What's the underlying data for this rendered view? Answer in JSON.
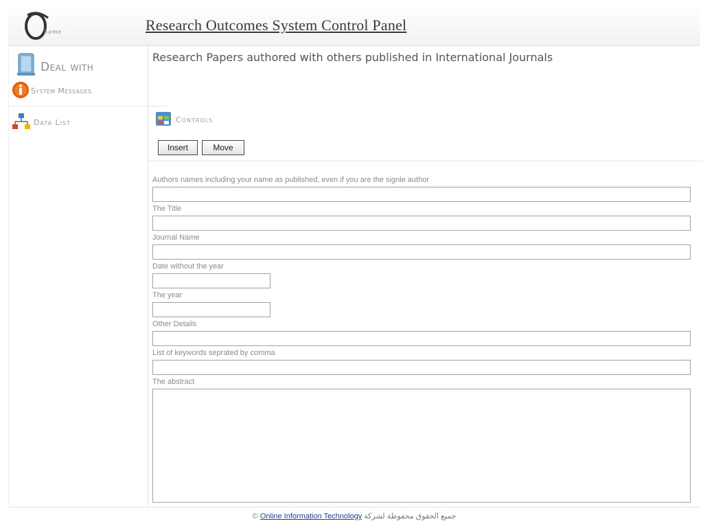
{
  "header": {
    "title": "Research Outcomes System Control Panel",
    "logo_text": "home"
  },
  "sidebar": {
    "deal_with": "Deal with",
    "system_messages": "System Messages",
    "data_list": "Data List"
  },
  "main": {
    "heading": "Research Papers authored with others published in International Journals",
    "controls_label": "Controls",
    "insert_label": "Insert",
    "move_label": "Move",
    "fields": {
      "authors": "Authors names including your name as published, even if you are the signle author",
      "title": "The Title",
      "journal": "Journal Name",
      "date": "Date without the year",
      "year": "The year",
      "other": "Other Details",
      "keywords": "List of keywords seprated by comma",
      "abstract": "The abstract"
    }
  },
  "footer": {
    "copyright": "©",
    "company_link": "Online Information Technology",
    "arabic_text": "جميع الحقوق محفوظة لشركة"
  },
  "colors": {
    "link": "#1a3fa8",
    "input_border": "#9aa2ab",
    "title_text": "#3a3a3a"
  }
}
